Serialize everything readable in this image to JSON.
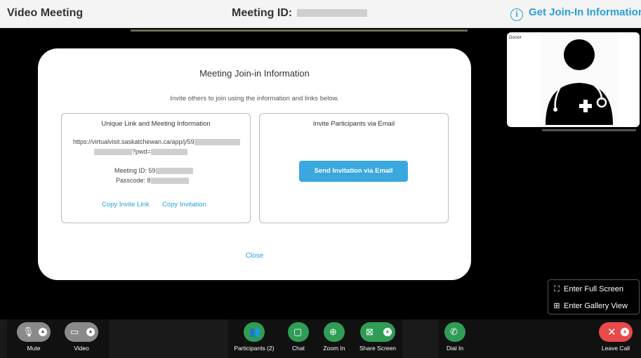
{
  "topbar": {
    "title": "Video Meeting",
    "meeting_id_label": "Meeting ID:",
    "join_info_link": "Get Join-In Information"
  },
  "self_view": {
    "label": "Doctor"
  },
  "modal": {
    "title": "Meeting Join-in Information",
    "subtitle": "Invite others to join using the information and links below.",
    "left_box": {
      "title": "Unique Link and Meeting Information",
      "link_line1": "https://virtualvisit.saskatchewan.ca/app/j/59",
      "link_line2": "?pwd=",
      "meeting_id": "Meeting ID: 59",
      "passcode": "Passcode: 8",
      "copy_invite_link": "Copy Invite Link",
      "copy_invitation": "Copy Invitation"
    },
    "right_box": {
      "title": "Invite Participants via Email",
      "send_button": "Send Invitation via Email"
    },
    "close": "Close"
  },
  "screen_menu": {
    "full_screen": "Enter Full Screen",
    "gallery_view": "Enter Gallery View"
  },
  "toolbar": {
    "mute": "Mute",
    "video": "Video",
    "participants": "Participants (2)",
    "chat": "Chat",
    "zoom_in": "Zoom In",
    "share_screen": "Share Screen",
    "dial_in": "Dial In",
    "leave_call": "Leave Call"
  },
  "icons": {
    "info": "info-icon",
    "mic": "microphone-icon",
    "camera": "camera-icon",
    "participants": "participants-icon",
    "chat": "chat-icon",
    "zoom": "zoom-in-icon",
    "share": "share-screen-icon",
    "phone": "phone-icon",
    "leave": "close-icon",
    "fullscreen": "fullscreen-icon",
    "gallery": "gallery-icon"
  },
  "colors": {
    "accent": "#2a9fd6",
    "green": "#2f9d55",
    "red": "#e84a4a"
  }
}
